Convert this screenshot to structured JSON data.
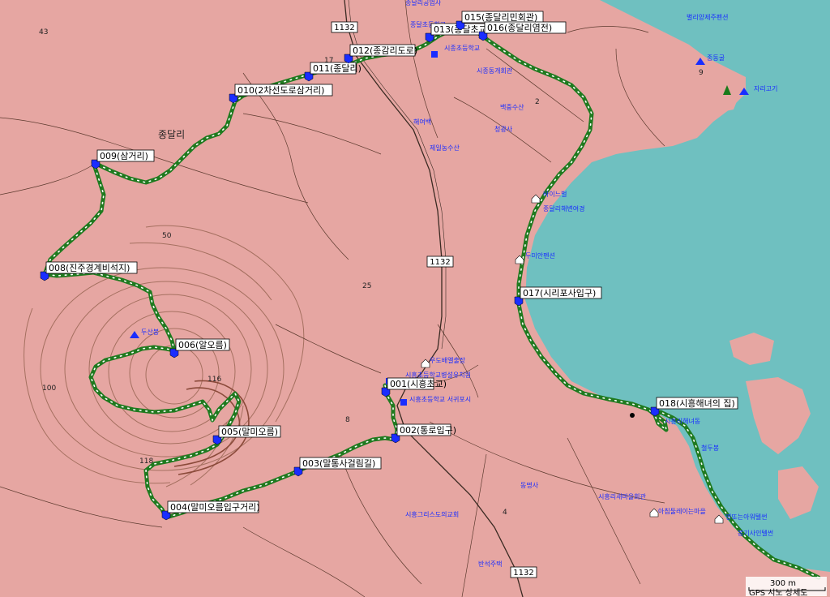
{
  "colors": {
    "land": "#e6a6a2",
    "sea": "#6fc0c0",
    "route": "#1f7a1f",
    "route_dot": "#ffffff",
    "contour": "#a57060",
    "poi_text": "#1a2dff",
    "road": "#6e4b3b"
  },
  "place_name": "종달리",
  "route_label": "1132",
  "route_label_2": "1132",
  "route_label_3": "1132",
  "scale": {
    "distance": "300 m",
    "credit": "GPS 시노 상세도"
  },
  "waypoints": [
    {
      "label": "001(시흥초교)"
    },
    {
      "label": "002(통로입구)"
    },
    {
      "label": "003(말통사걸림길)"
    },
    {
      "label": "004(말미오름입구거리)"
    },
    {
      "label": "005(말미오름)"
    },
    {
      "label": "006(알오름)"
    },
    {
      "label": "008(진주경계비석지)"
    },
    {
      "label": "009(삼거리)"
    },
    {
      "label": "010(2차선도로삼거리)"
    },
    {
      "label": "011(종달리)"
    },
    {
      "label": "012(종감리도로)"
    },
    {
      "label": "013(종달초교)"
    },
    {
      "label": "015(종달리민회관)"
    },
    {
      "label": "016(종달리염전)"
    },
    {
      "label": "017(시리포사입구)"
    },
    {
      "label": "018(시흥해녀의 집)"
    }
  ],
  "pois": [
    {
      "label": "종달리공업사"
    },
    {
      "label": "종달초등학교"
    },
    {
      "label": "시종초등학교"
    },
    {
      "label": "시종동개회관"
    },
    {
      "label": "백중수산"
    },
    {
      "label": "해여백"
    },
    {
      "label": "제일농수산"
    },
    {
      "label": "청광사"
    },
    {
      "label": "바이느벌"
    },
    {
      "label": "종달리해변여경"
    },
    {
      "label": "두미안펜션"
    },
    {
      "label": "두산봉"
    },
    {
      "label": "우도배앨출장"
    },
    {
      "label": "시흥초등학교병설유치원"
    },
    {
      "label": "시흥초등학교 서귀포시"
    },
    {
      "label": "시흥그리스도의교회"
    },
    {
      "label": "동명사"
    },
    {
      "label": "시흥리새마을회관"
    },
    {
      "label": "아침둘레이는마을"
    },
    {
      "label": "시흥리해녀동"
    },
    {
      "label": "철두봉"
    },
    {
      "label": "명또는아워텔썬"
    },
    {
      "label": "봉기사인텔썬"
    },
    {
      "label": "반석주택"
    },
    {
      "label": "별리양제주펜션"
    },
    {
      "label": "종동굴"
    },
    {
      "label": "자리고기"
    }
  ],
  "elevations": [
    "43",
    "50",
    "25",
    "116",
    "118",
    "100",
    "8",
    "4",
    "2",
    "9",
    "17"
  ]
}
